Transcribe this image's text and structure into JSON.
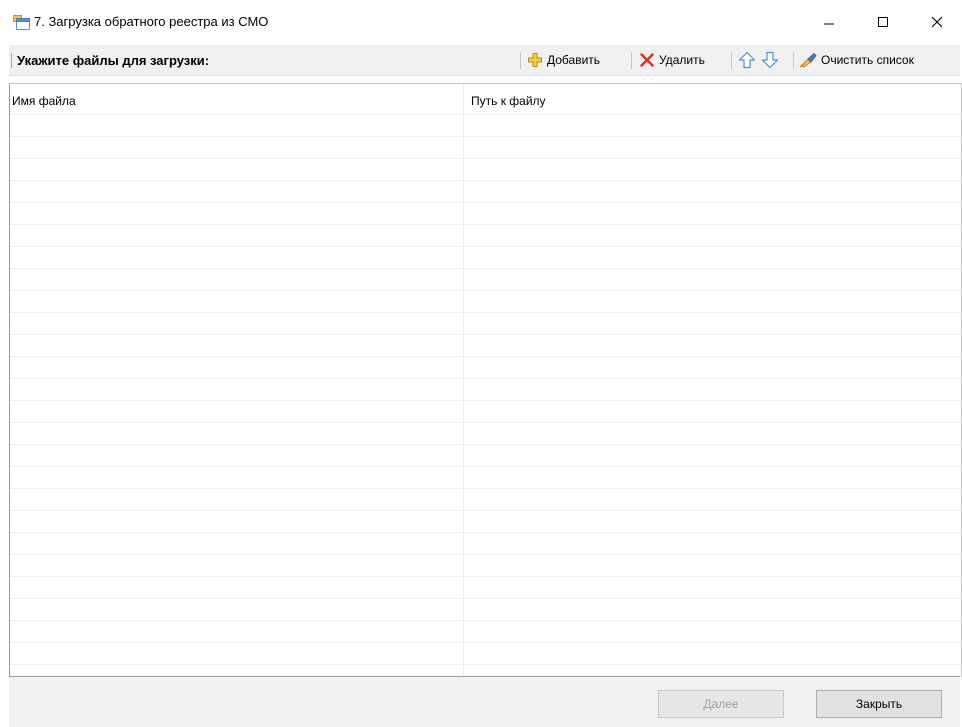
{
  "window": {
    "title": "7. Загрузка обратного реестра из СМО",
    "icon": "app-window-icon"
  },
  "toolbar": {
    "caption": "Укажите файлы для загрузки:",
    "add_label": "Добавить",
    "delete_label": "Удалить",
    "clear_label": "Очистить список",
    "icons": [
      "add-icon",
      "delete-icon",
      "move-up-icon",
      "move-down-icon",
      "clear-list-icon"
    ]
  },
  "grid": {
    "columns": [
      "Имя файла",
      "Путь к файлу"
    ],
    "rows": []
  },
  "footer": {
    "next_label": "Далее",
    "close_label": "Закрыть"
  },
  "colors": {
    "add_icon": "#f5c518",
    "delete_icon": "#e52a20",
    "arrow_icon": "#4a8fe0",
    "disabled_text": "#a0a0a0"
  }
}
